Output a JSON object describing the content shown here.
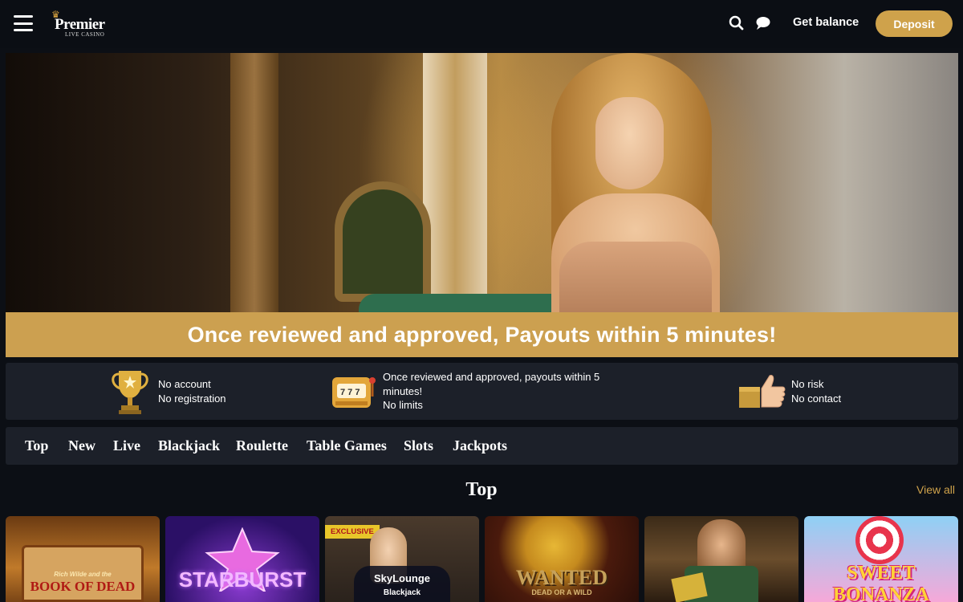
{
  "header": {
    "logo_name": "Premier",
    "logo_sub": "LIVE CASINO",
    "get_balance": "Get balance",
    "deposit": "Deposit",
    "icons": [
      "menu-icon",
      "search-icon",
      "chat-icon"
    ]
  },
  "promo": {
    "banner_text": "Once reviewed and approved, Payouts within 5 minutes!"
  },
  "features": [
    {
      "icon": "trophy-icon",
      "lines": [
        "No account",
        "No registration"
      ]
    },
    {
      "icon": "slot-machine-icon",
      "lines": [
        "Once reviewed and approved, payouts within 5",
        "minutes!",
        "No limits"
      ]
    },
    {
      "icon": "thumbs-up-icon",
      "lines": [
        "No risk",
        "No contact"
      ]
    }
  ],
  "categories": [
    "Top",
    "New",
    "Live",
    "Blackjack",
    "Roulette",
    "Table Games",
    "Slots",
    "Jackpots"
  ],
  "section": {
    "title": "Top",
    "view_all": "View all"
  },
  "games": [
    {
      "title": "BOOK OF DEAD",
      "subtitle": "Rich Wilde and the"
    },
    {
      "title": "STARBURST",
      "subtitle": ""
    },
    {
      "title": "SkyLounge",
      "subtitle": "Blackjack",
      "badge": "EXCLUSIVE"
    },
    {
      "title": "WANTED",
      "subtitle": "DEAD OR A WILD"
    },
    {
      "title": "",
      "subtitle": ""
    },
    {
      "title": "SWEET BONANZA",
      "subtitle": ""
    }
  ],
  "colors": {
    "accent": "#cfa24b",
    "background": "#0c0f15",
    "panel": "#1c2029",
    "banner": "#cca050"
  }
}
